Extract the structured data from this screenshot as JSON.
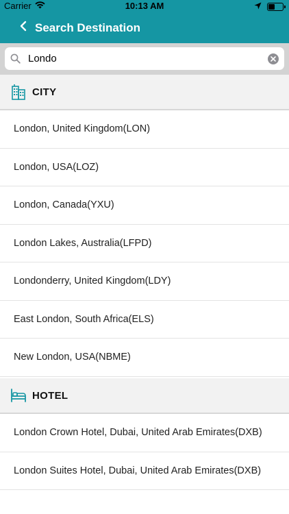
{
  "status_bar": {
    "carrier": "Carrier",
    "time": "10:13 AM",
    "battery_level": 0.45
  },
  "nav": {
    "title": "Search Destination",
    "back_icon": "chevron-left-icon"
  },
  "search": {
    "value": "Londo",
    "placeholder": "",
    "icon": "search-icon",
    "clear_icon": "clear-icon"
  },
  "sections": {
    "city": {
      "label": "CITY",
      "icon": "city-icon",
      "items": [
        "London, United Kingdom(LON)",
        "London, USA(LOZ)",
        "London, Canada(YXU)",
        "London Lakes, Australia(LFPD)",
        "Londonderry, United Kingdom(LDY)",
        "East London, South Africa(ELS)",
        "New London, USA(NBME)"
      ]
    },
    "hotel": {
      "label": "HOTEL",
      "icon": "hotel-bed-icon",
      "items": [
        "London Crown Hotel, Dubai, United Arab Emirates(DXB)",
        "London Suites Hotel, Dubai, United Arab Emirates(DXB)"
      ]
    }
  },
  "colors": {
    "brand": "#1596a3",
    "section_bg": "#f2f2f2",
    "search_bg": "#d3d3d3"
  }
}
